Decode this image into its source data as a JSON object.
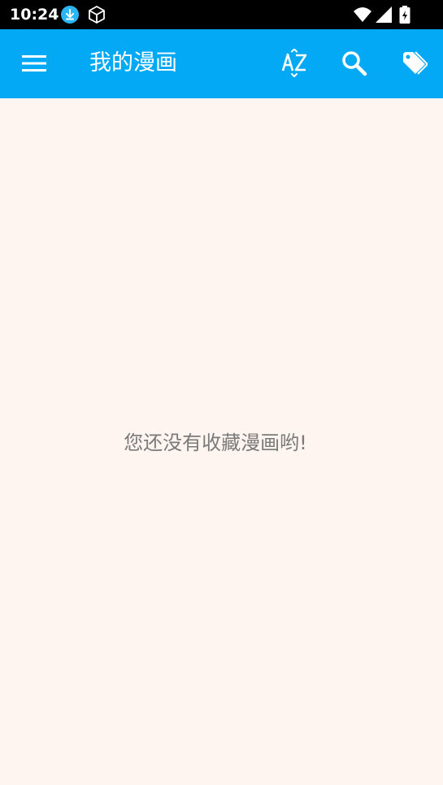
{
  "status_bar": {
    "time": "10:24",
    "icons": [
      "download-icon",
      "package-icon",
      "wifi-icon",
      "signal-icon",
      "battery-charging-icon"
    ]
  },
  "toolbar": {
    "title": "我的漫画",
    "background_color": "#03A9F4",
    "icons": [
      "menu-icon",
      "sort-az-icon",
      "search-icon",
      "tag-icon"
    ]
  },
  "main": {
    "background_color": "#FFF5F0",
    "empty_message": "您还没有收藏漫画哟!"
  }
}
